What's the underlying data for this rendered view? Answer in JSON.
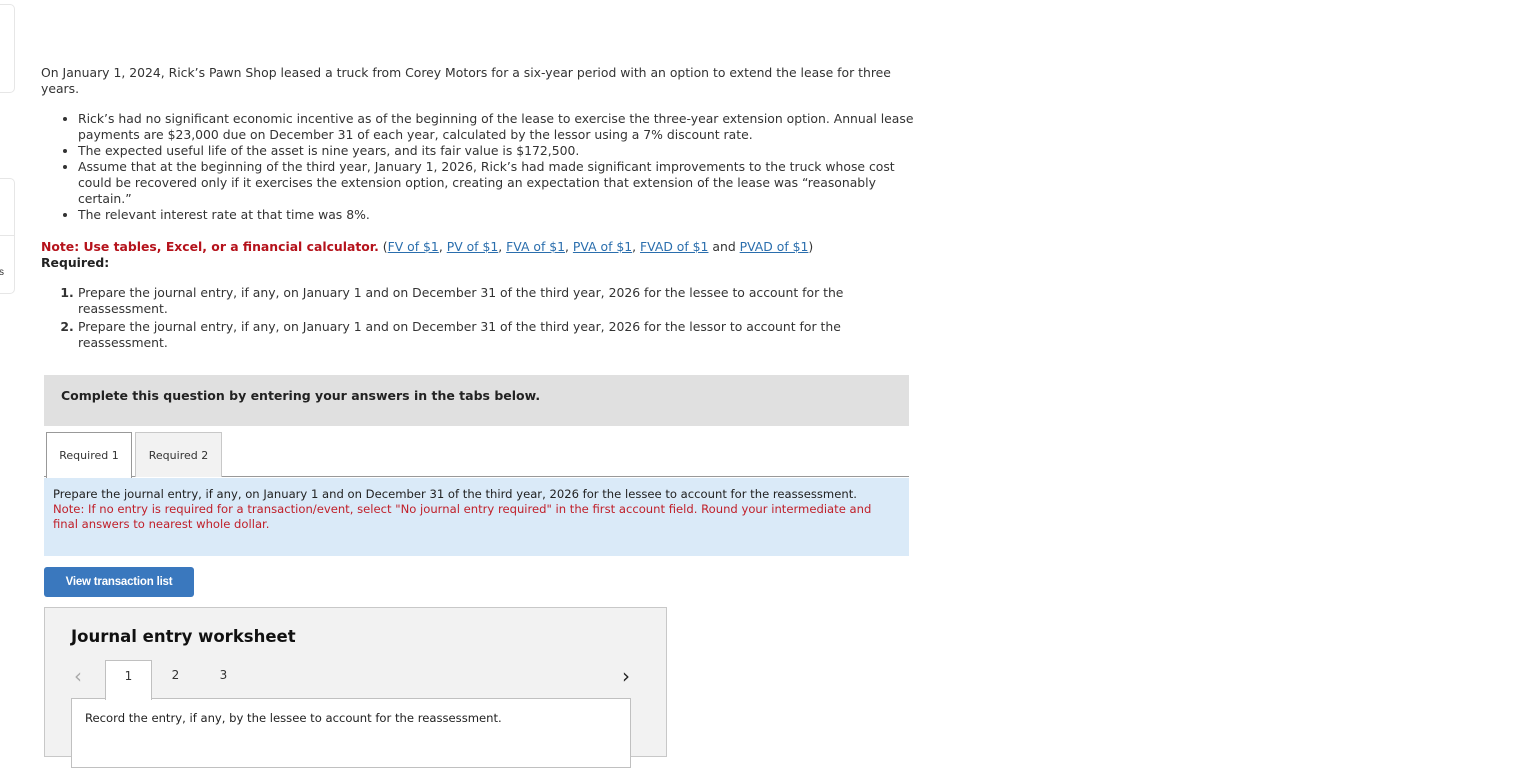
{
  "sidebar": {
    "partial_label": "s"
  },
  "question": {
    "intro": "On January 1, 2024, Rick’s Pawn Shop leased a truck from Corey Motors for a six-year period with an option to extend the lease for three years.",
    "bullets": [
      "Rick’s had no significant economic incentive as of the beginning of the lease to exercise the three-year extension option. Annual lease payments are $23,000 due on December 31 of each year, calculated by the lessor using a 7% discount rate.",
      "The expected useful life of the asset is nine years, and its fair value is $172,500.",
      "Assume that at the beginning of the third year, January 1, 2026, Rick’s had made significant improvements to the truck whose cost could be recovered only if it exercises the extension option, creating an expectation that extension of the lease was “reasonably certain.”",
      "The relevant interest rate at that time was 8%."
    ],
    "note_label": "Note: Use tables, Excel, or a financial calculator.",
    "links": {
      "open": " (",
      "fv": "FV of $1",
      "pv": "PV of $1",
      "fva": "FVA of $1",
      "pva": "PVA of $1",
      "fvad": "FVAD of $1",
      "and": " and ",
      "pvad": "PVAD of $1",
      "sep": ", ",
      "close": ")"
    },
    "required_heading": "Required:",
    "requirements": [
      "Prepare the journal entry, if any, on January 1 and on December 31 of the third year, 2026 for the lessee to account for the reassessment.",
      "Prepare the journal entry, if any, on January 1 and on December 31 of the third year, 2026 for the lessor to account for the reassessment."
    ]
  },
  "complete_box": "Complete this question by entering your answers in the tabs below.",
  "tabs": [
    {
      "label": "Required 1",
      "active": true
    },
    {
      "label": "Required 2",
      "active": false
    }
  ],
  "instructions": {
    "text": "Prepare the journal entry, if any, on January 1 and on December 31 of the third year, 2026 for the lessee to account for the reassessment.",
    "note": "Note: If no entry is required for a transaction/event, select \"No journal entry required\" in the first account field. Round your intermediate and final answers to nearest whole dollar."
  },
  "view_transaction_button": "View transaction list",
  "worksheet": {
    "title": "Journal entry worksheet",
    "prev_icon": "‹",
    "next_icon": "›",
    "pages": [
      "1",
      "2",
      "3"
    ],
    "active_page": "1",
    "content": "Record the entry, if any, by the lessee to account for the reassessment."
  }
}
